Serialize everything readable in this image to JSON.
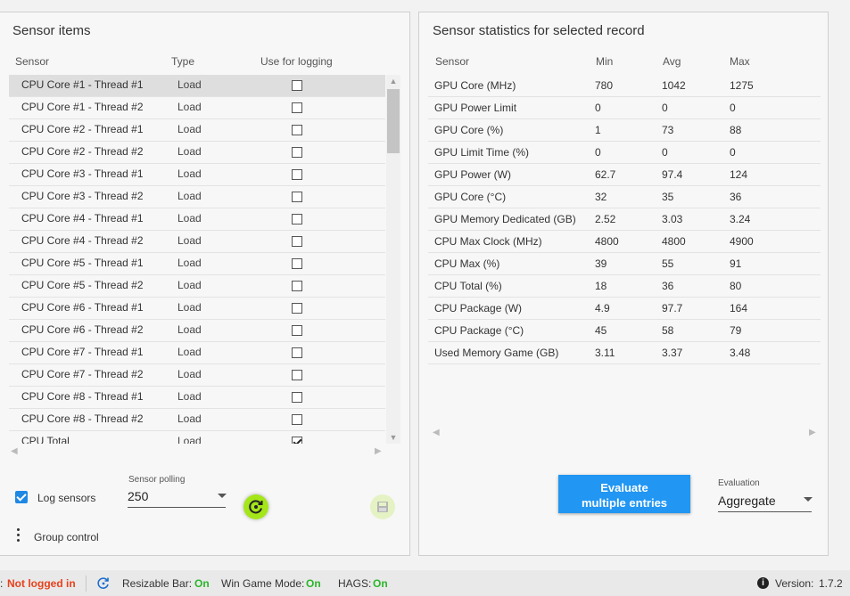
{
  "left_panel": {
    "title": "Sensor items",
    "headers": {
      "sensor": "Sensor",
      "type": "Type",
      "use": "Use for logging"
    },
    "rows": [
      {
        "name": "CPU Core #1 - Thread #1",
        "type": "Load",
        "checked": false,
        "selected": true
      },
      {
        "name": "CPU Core #1 - Thread #2",
        "type": "Load",
        "checked": false
      },
      {
        "name": "CPU Core #2 - Thread #1",
        "type": "Load",
        "checked": false
      },
      {
        "name": "CPU Core #2 - Thread #2",
        "type": "Load",
        "checked": false
      },
      {
        "name": "CPU Core #3 - Thread #1",
        "type": "Load",
        "checked": false
      },
      {
        "name": "CPU Core #3 - Thread #2",
        "type": "Load",
        "checked": false
      },
      {
        "name": "CPU Core #4 - Thread #1",
        "type": "Load",
        "checked": false
      },
      {
        "name": "CPU Core #4 - Thread #2",
        "type": "Load",
        "checked": false
      },
      {
        "name": "CPU Core #5 - Thread #1",
        "type": "Load",
        "checked": false
      },
      {
        "name": "CPU Core #5 - Thread #2",
        "type": "Load",
        "checked": false
      },
      {
        "name": "CPU Core #6 - Thread #1",
        "type": "Load",
        "checked": false
      },
      {
        "name": "CPU Core #6 - Thread #2",
        "type": "Load",
        "checked": false
      },
      {
        "name": "CPU Core #7 - Thread #1",
        "type": "Load",
        "checked": false
      },
      {
        "name": "CPU Core #7 - Thread #2",
        "type": "Load",
        "checked": false
      },
      {
        "name": "CPU Core #8 - Thread #1",
        "type": "Load",
        "checked": false
      },
      {
        "name": "CPU Core #8 - Thread #2",
        "type": "Load",
        "checked": false
      },
      {
        "name": "CPU Total",
        "type": "Load",
        "checked": true
      }
    ],
    "log_sensors": {
      "label": "Log sensors",
      "checked": true
    },
    "sensor_polling": {
      "caption": "Sensor polling",
      "value": "250"
    },
    "group_control": "Group control"
  },
  "right_panel": {
    "title": "Sensor statistics for selected record",
    "headers": [
      "Sensor",
      "Min",
      "Avg",
      "Max"
    ],
    "rows": [
      [
        "GPU Core (MHz)",
        "780",
        "1042",
        "1275"
      ],
      [
        "GPU Power Limit",
        "0",
        "0",
        "0"
      ],
      [
        "GPU Core (%)",
        "1",
        "73",
        "88"
      ],
      [
        "GPU Limit Time (%)",
        "0",
        "0",
        "0"
      ],
      [
        "GPU Power (W)",
        "62.7",
        "97.4",
        "124"
      ],
      [
        "GPU Core (°C)",
        "32",
        "35",
        "36"
      ],
      [
        "GPU Memory Dedicated (GB)",
        "2.52",
        "3.03",
        "3.24"
      ],
      [
        "CPU Max Clock (MHz)",
        "4800",
        "4800",
        "4900"
      ],
      [
        "CPU Max (%)",
        "39",
        "55",
        "91"
      ],
      [
        "CPU Total (%)",
        "18",
        "36",
        "80"
      ],
      [
        "CPU Package (W)",
        "4.9",
        "97.7",
        "164"
      ],
      [
        "CPU Package (°C)",
        "45",
        "58",
        "79"
      ],
      [
        "Used Memory Game (GB)",
        "3.11",
        "3.37",
        "3.48"
      ]
    ],
    "evaluate_button": {
      "line1": "Evaluate",
      "line2": "multiple entries"
    },
    "evaluation": {
      "caption": "Evaluation",
      "value": "Aggregate"
    }
  },
  "status_bar": {
    "login_prefix": ":",
    "login_status": "Not logged in",
    "resizable_bar_label": "Resizable Bar:",
    "resizable_bar_value": "On",
    "win_game_mode_label": "Win Game Mode:",
    "win_game_mode_value": "On",
    "hags_label": "HAGS:",
    "hags_value": "On",
    "version_label": "Version:",
    "version_value": "1.7.2"
  },
  "colors": {
    "accent": "#2196f3",
    "refresh_button": "#a4e61a",
    "status_on": "#2bb52b",
    "status_off": "#e8411c"
  }
}
